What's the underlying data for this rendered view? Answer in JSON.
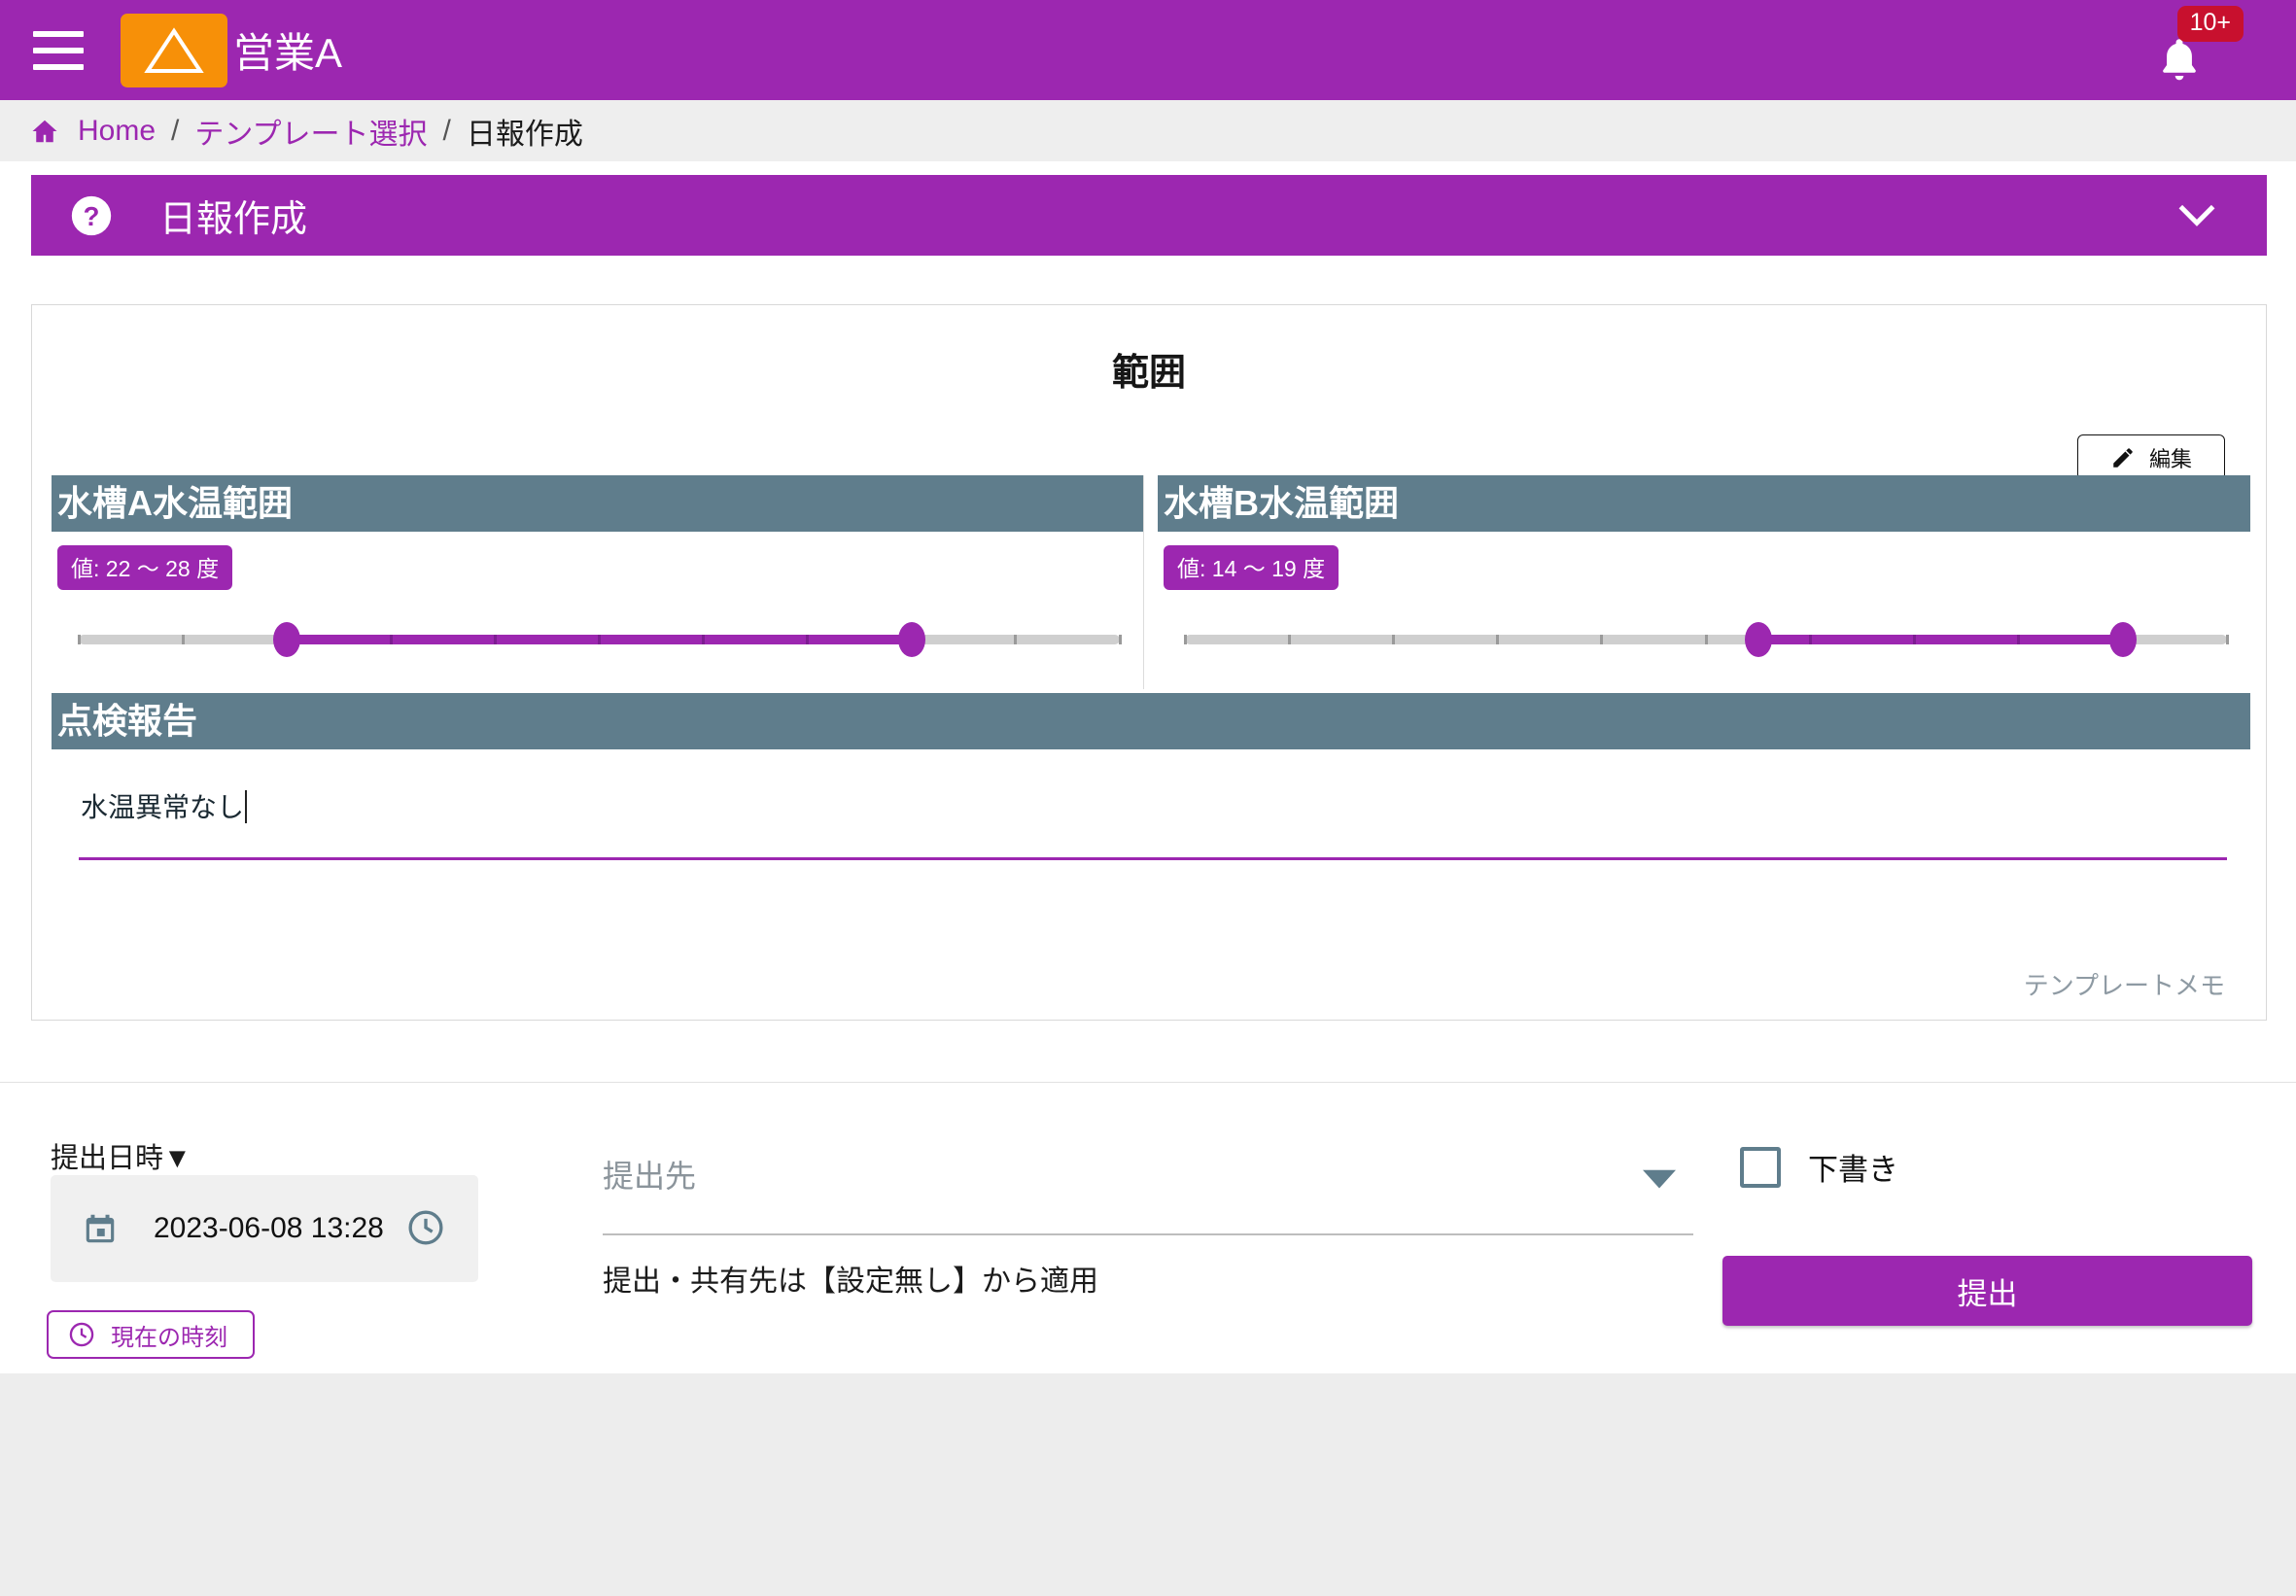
{
  "appbar": {
    "menu_icon": "hamburger-icon",
    "logo_icon": "triangle-logo",
    "org_name": "営業A",
    "bell_icon": "bell-icon",
    "notification_badge": "10+",
    "bg_color": "#9c27b0",
    "logo_color": "#f79008",
    "badge_color": "#c8102e"
  },
  "breadcrumb": {
    "home_icon": "home-icon",
    "home_label": "Home",
    "sep": "/",
    "template_label": "テンプレート選択",
    "current_label": "日報作成",
    "link_color": "#9c27b0"
  },
  "section_header": {
    "help_icon": "help-circle-icon",
    "title": "日報作成",
    "collapse_icon": "chevron-down-icon"
  },
  "card": {
    "title": "範囲",
    "edit_button": {
      "icon": "pencil-icon",
      "label": "編集"
    },
    "template_memo": "テンプレートメモ",
    "fields": [
      {
        "header": "水槽A水温範囲",
        "value_badge": "値: 22 〜 28 度",
        "slider": {
          "min_pct": 20,
          "max_pct": 80,
          "tick_count": 11
        }
      },
      {
        "header": "水槽B水温範囲",
        "value_badge": "値: 14 〜 19 度",
        "slider": {
          "min_pct": 55,
          "max_pct": 90,
          "tick_count": 11
        }
      }
    ],
    "report": {
      "header": "点検報告",
      "value": "水温異常なし"
    }
  },
  "submit_panel": {
    "datetime_label": "提出日時▼",
    "calendar_icon": "calendar-icon",
    "datetime_value": "2023-06-08 13:28",
    "clock_icon": "clock-icon",
    "now_button": {
      "icon": "clock-icon",
      "label": "現在の時刻"
    },
    "destination": {
      "placeholder": "提出先",
      "dropdown_icon": "caret-down-icon",
      "help_text": "提出・共有先は【設定無し】から適用"
    },
    "draft": {
      "checkbox_icon": "checkbox-unchecked-icon",
      "label": "下書き",
      "checked": false
    },
    "submit_label": "提出",
    "accent_color": "#9c27b0"
  }
}
